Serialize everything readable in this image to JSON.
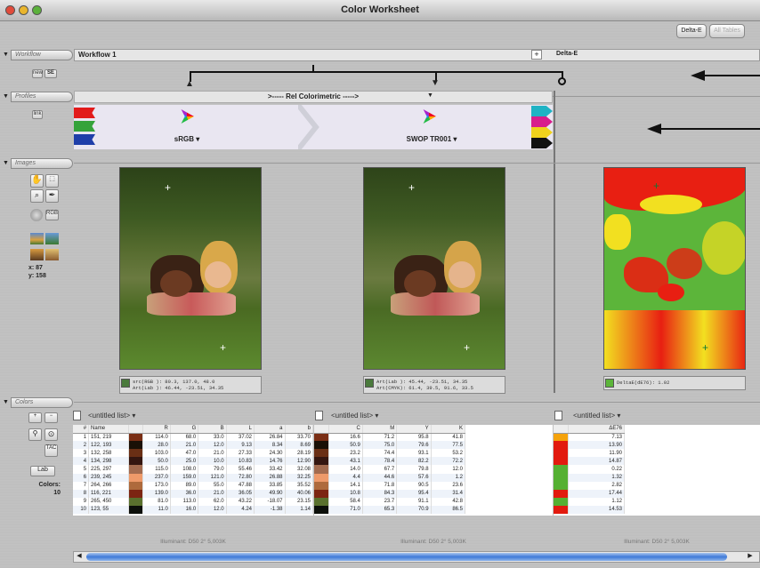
{
  "window": {
    "title": "Color Worksheet"
  },
  "toolbar": {
    "delta_label": "Delta-E",
    "select_label": "All Tables"
  },
  "workflow": {
    "tab": "Workflow",
    "name": "Workflow 1",
    "new_label": "new",
    "se_label": "SE",
    "plus_label": "+",
    "delta_label": "Delta-E"
  },
  "profiles": {
    "tab": "Profiles",
    "link_label": "link",
    "intent": ">----- Rel Colorimetric ----->",
    "source": "sRGB ▾",
    "dest": "SWOP TR001 ▾"
  },
  "images": {
    "tab": "Images",
    "x_label": "x: 87",
    "y_label": "y: 158",
    "readout1": [
      "src(RGB ): 80.3, 137.0, 48.0",
      "Art(Lab ): 46.44, -23.51, 34.35"
    ],
    "readout2": [
      "Art(Lab ): 45.44, -23.51, 34.35",
      "Art(CMYK): 61.4, 39.5, 91.6, 33.5"
    ],
    "readout3": "DeltaE(dE76): 1.02"
  },
  "colors": {
    "tab": "Colors",
    "list_label": "<untitled list>",
    "lab_label": "Lab",
    "colors_label": "Colors:",
    "colors_count": "10",
    "hdr_left": [
      "#",
      "Name",
      "R",
      "G",
      "B",
      "L",
      "a",
      "b"
    ],
    "hdr_mid": [
      "C",
      "M",
      "Y",
      "K"
    ],
    "hdr_right": "ΔE76",
    "illuminant": "Illuminant: D50 2° 5,003K"
  },
  "rows": [
    {
      "n": "1",
      "name": "151, 219",
      "sw": "#7a2e14",
      "R": "114.0",
      "G": "68.0",
      "B": "33.0",
      "L": "37.02",
      "a": "26.84",
      "b": "33.70",
      "C": "16.6",
      "M": "71.2",
      "Y": "95.8",
      "K": "41.8",
      "de": "7.13",
      "dc": "#f5a20a"
    },
    {
      "n": "2",
      "name": "122, 193",
      "sw": "#1a1006",
      "R": "28.0",
      "G": "21.0",
      "B": "12.0",
      "L": "9.13",
      "a": "8.34",
      "b": "8.69",
      "C": "50.9",
      "M": "75.0",
      "Y": "79.6",
      "K": "77.5",
      "de": "13.90",
      "dc": "#e21a0e"
    },
    {
      "n": "3",
      "name": "132, 258",
      "sw": "#6a2f15",
      "R": "103.0",
      "G": "47.0",
      "B": "21.0",
      "L": "27.33",
      "a": "24.30",
      "b": "28.19",
      "C": "23.2",
      "M": "74.4",
      "Y": "93.1",
      "K": "53.2",
      "de": "11.90",
      "dc": "#e21a0e"
    },
    {
      "n": "4",
      "name": "134, 298",
      "sw": "#341610",
      "R": "50.0",
      "G": "25.0",
      "B": "10.0",
      "L": "10.83",
      "a": "14.76",
      "b": "12.90",
      "C": "43.1",
      "M": "78.4",
      "Y": "82.2",
      "K": "72.2",
      "de": "14.87",
      "dc": "#e21a0e"
    },
    {
      "n": "5",
      "name": "225, 297",
      "sw": "#a36b4f",
      "R": "115.0",
      "G": "108.0",
      "B": "79.0",
      "L": "55.46",
      "a": "33.42",
      "b": "32.08",
      "C": "14.0",
      "M": "67.7",
      "Y": "79.8",
      "K": "12.0",
      "de": "0.22",
      "dc": "#55b032"
    },
    {
      "n": "6",
      "name": "239, 245",
      "sw": "#ee9a6a",
      "R": "237.0",
      "G": "159.0",
      "B": "121.0",
      "L": "72.80",
      "a": "26.88",
      "b": "32.25",
      "C": "4.4",
      "M": "44.6",
      "Y": "57.6",
      "K": "1.2",
      "de": "1.32",
      "dc": "#55b032"
    },
    {
      "n": "7",
      "name": "264, 266",
      "sw": "#ae6a3c",
      "R": "173.0",
      "G": "89.0",
      "B": "55.0",
      "L": "47.88",
      "a": "33.85",
      "b": "35.52",
      "C": "14.1",
      "M": "71.8",
      "Y": "90.5",
      "K": "23.6",
      "de": "2.82",
      "dc": "#55b032"
    },
    {
      "n": "8",
      "name": "116, 221",
      "sw": "#7c2512",
      "R": "139.0",
      "G": "36.0",
      "B": "21.0",
      "L": "36.05",
      "a": "49.90",
      "b": "40.06",
      "C": "10.8",
      "M": "84.3",
      "Y": "95.4",
      "K": "31.4",
      "de": "17.44",
      "dc": "#e21a0e"
    },
    {
      "n": "9",
      "name": "265, 450",
      "sw": "#5a712e",
      "R": "81.0",
      "G": "113.0",
      "B": "62.0",
      "L": "43.22",
      "a": "-18.07",
      "b": "23.15",
      "C": "58.4",
      "M": "23.7",
      "Y": "91.1",
      "K": "42.8",
      "de": "1.12",
      "dc": "#55b032"
    },
    {
      "n": "10",
      "name": "123, 55",
      "sw": "#0c0f0a",
      "R": "11.0",
      "G": "16.0",
      "B": "12.0",
      "L": "4.24",
      "a": "-1.38",
      "b": "1.14",
      "C": "71.0",
      "M": "65.3",
      "Y": "70.9",
      "K": "86.5",
      "de": "14.53",
      "dc": "#e21a0e"
    }
  ]
}
